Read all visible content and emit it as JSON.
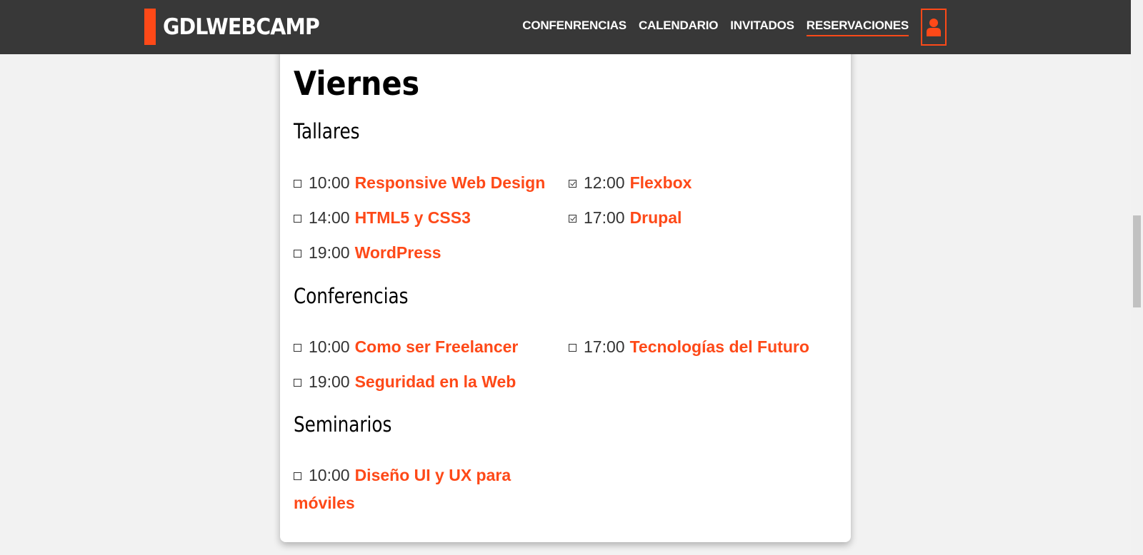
{
  "header": {
    "brand": "GDLWEBCAMP",
    "nav": [
      {
        "label": "CONFENRENCIAS"
      },
      {
        "label": "CALENDARIO"
      },
      {
        "label": "INVITADOS"
      },
      {
        "label": "RESERVACIONES",
        "active": true
      }
    ],
    "user_icon": "user-icon"
  },
  "day": {
    "title": "Viernes",
    "categories": [
      {
        "title": "Tallares",
        "events": [
          {
            "time": "10:00",
            "name": "Responsive Web Design",
            "checked": false
          },
          {
            "time": "12:00",
            "name": "Flexbox",
            "checked": true
          },
          {
            "time": "14:00",
            "name": "HTML5 y CSS3",
            "checked": false
          },
          {
            "time": "17:00",
            "name": "Drupal",
            "checked": true
          },
          {
            "time": "19:00",
            "name": "WordPress",
            "checked": false
          }
        ]
      },
      {
        "title": "Conferencias",
        "events": [
          {
            "time": "10:00",
            "name": "Como ser Freelancer",
            "checked": false
          },
          {
            "time": "17:00",
            "name": "Tecnologías del Futuro",
            "checked": false
          },
          {
            "time": "19:00",
            "name": "Seguridad en la Web",
            "checked": false
          }
        ]
      },
      {
        "title": "Seminarios",
        "events": [
          {
            "time": "10:00",
            "name": "Diseño UI y UX para móviles",
            "checked": false
          }
        ]
      }
    ]
  },
  "colors": {
    "accent": "#fe4918",
    "header_bg": "#383838",
    "page_bg": "#f2f2f2"
  }
}
